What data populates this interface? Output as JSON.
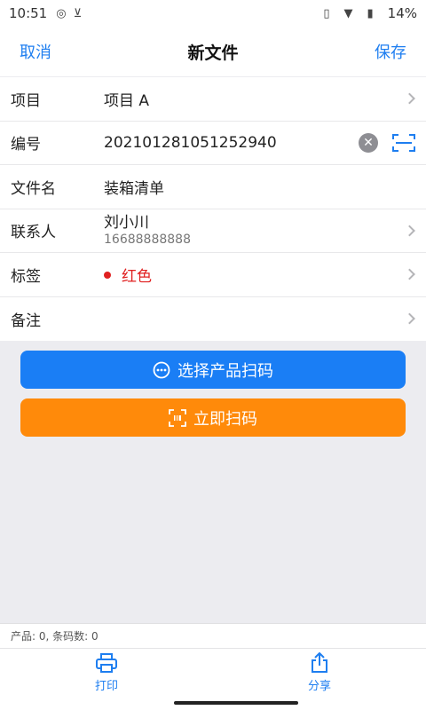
{
  "status": {
    "time": "10:51",
    "battery": "14%"
  },
  "nav": {
    "cancel": "取消",
    "title": "新文件",
    "save": "保存"
  },
  "form": {
    "project": {
      "label": "项目",
      "value": "项目 A"
    },
    "number": {
      "label": "编号",
      "value": "202101281051252940"
    },
    "filename": {
      "label": "文件名",
      "value": "装箱清单"
    },
    "contact": {
      "label": "联系人",
      "name": "刘小川",
      "phone": "16688888888"
    },
    "tag": {
      "label": "标签",
      "value": "红色",
      "color": "#e02020"
    },
    "note": {
      "label": "备注",
      "value": ""
    }
  },
  "buttons": {
    "select_scan": "选择产品扫码",
    "scan_now": "立即扫码"
  },
  "footer": {
    "summary": "产品: 0, 条码数: 0"
  },
  "tabs": [
    {
      "label": "打印",
      "icon": "printer-icon"
    },
    {
      "label": "分享",
      "icon": "share-icon"
    }
  ],
  "colors": {
    "accent": "#1e7ef0",
    "primary_button": "#1a7ef5",
    "secondary_button": "#ff8a0a"
  }
}
